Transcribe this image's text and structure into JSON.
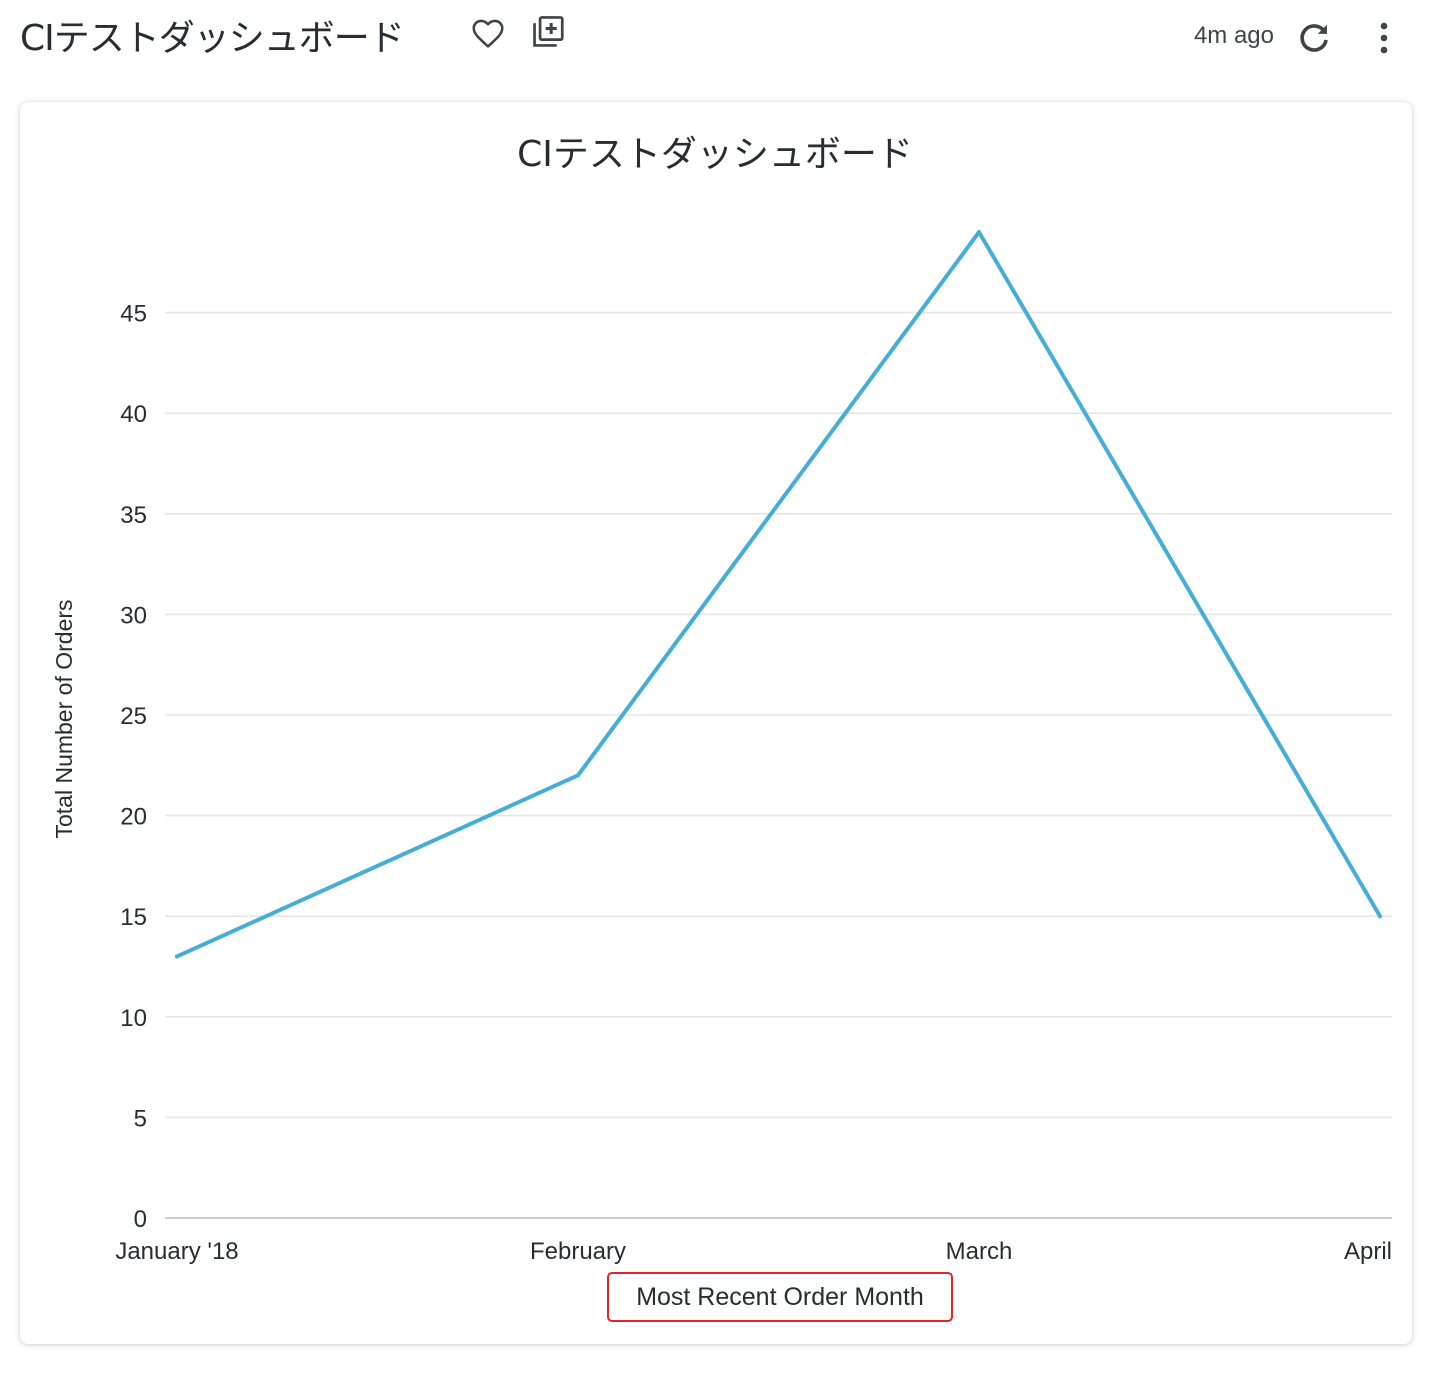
{
  "dashboard": {
    "title": "CIテストダッシュボード",
    "updated": "4m ago"
  },
  "icons": {
    "favorite": "heart-outline-icon",
    "copy": "library-add-icon",
    "reload": "reload-icon",
    "more": "more-vert-icon"
  },
  "colors": {
    "series": "#46aed6",
    "grid": "#e3e5e8",
    "highlight_border": "#e0262c"
  },
  "chart_data": {
    "type": "line",
    "title": "CIテストダッシュボード",
    "xlabel": "Most Recent Order Month",
    "ylabel": "Total Number of Orders",
    "categories": [
      "January '18",
      "February",
      "March",
      "April"
    ],
    "series": [
      {
        "values": [
          13,
          22,
          49,
          15
        ]
      }
    ],
    "ylim": [
      0,
      50
    ],
    "yticks": [
      0,
      5,
      10,
      15,
      20,
      25,
      30,
      35,
      40,
      45
    ],
    "grid": true,
    "legend": "none"
  }
}
